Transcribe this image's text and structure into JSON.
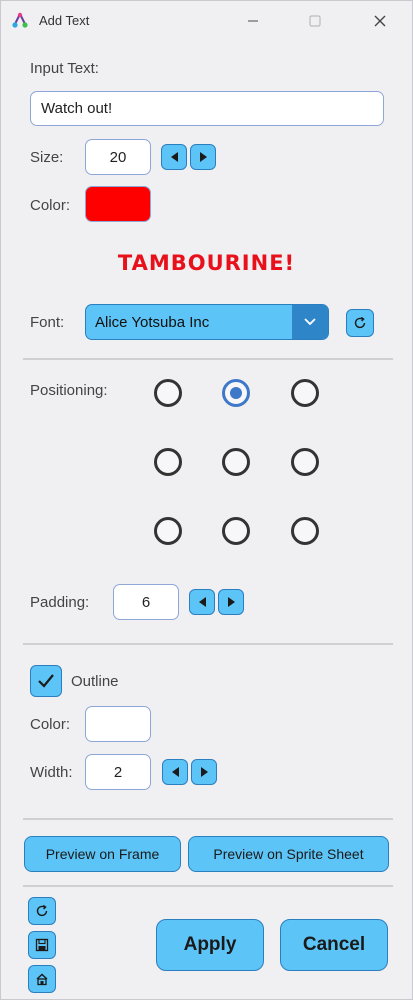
{
  "window": {
    "title": "Add Text"
  },
  "input_text": {
    "label": "Input Text:",
    "value": "Watch out!"
  },
  "size": {
    "label": "Size:",
    "value": "20"
  },
  "color": {
    "label": "Color:",
    "value": "#ff0000"
  },
  "preview": {
    "text": "TAMBOURINE!"
  },
  "font": {
    "label": "Font:",
    "selected": "Alice Yotsuba Inc"
  },
  "positioning": {
    "label": "Positioning:",
    "selected": "top-center"
  },
  "padding": {
    "label": "Padding:",
    "value": "6"
  },
  "outline": {
    "label": "Outline",
    "checked": true,
    "color_label": "Color:",
    "color_value": "#ffffff",
    "width_label": "Width:",
    "width_value": "2"
  },
  "buttons": {
    "preview_frame": "Preview on Frame",
    "preview_sheet": "Preview on Sprite Sheet",
    "apply": "Apply",
    "cancel": "Cancel"
  },
  "colors": {
    "accent": "#5cc4f6",
    "accent_dark": "#2e86c8",
    "radio_selected": "#3d78c9",
    "preview_text": "#e8101a"
  },
  "icons": [
    "app-icon",
    "minimize-icon",
    "maximize-icon",
    "close-icon",
    "arrow-left-icon",
    "arrow-right-icon",
    "chevron-down-icon",
    "refresh-icon",
    "checkmark-icon",
    "save-icon",
    "load-icon"
  ]
}
